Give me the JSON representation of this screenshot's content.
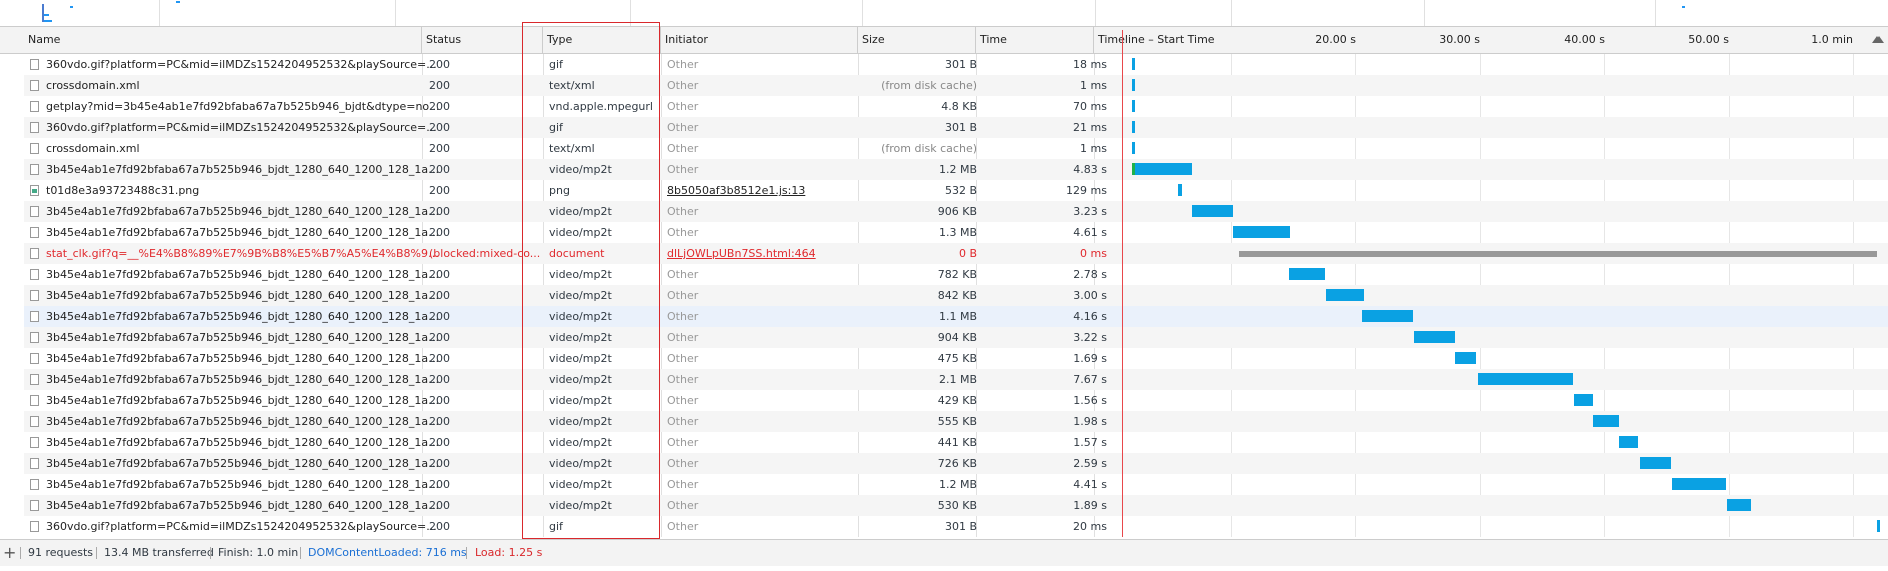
{
  "columns": {
    "name": "Name",
    "status": "Status",
    "type": "Type",
    "initiator": "Initiator",
    "size": "Size",
    "time": "Time",
    "timeline": "Timeline – Start Time"
  },
  "timeline_ticks": [
    "20.00 s",
    "30.00 s",
    "40.00 s",
    "50.00 s",
    "1.0 min"
  ],
  "rows": [
    {
      "name": "360vdo.gif?platform=PC&mid=ilMDZs1524204952532&playSource=...",
      "status": "200",
      "type": "gif",
      "initiator": "Other",
      "size": "301 B",
      "time": "18 ms",
      "icon": "file-icon"
    },
    {
      "name": "crossdomain.xml",
      "status": "200",
      "type": "text/xml",
      "initiator": "Other",
      "size": "(from disk cache)",
      "time": "1 ms",
      "icon": "file-icon"
    },
    {
      "name": "getplay?mid=3b45e4ab1e7fd92bfaba67a7b525b946_bjdt&dtype=no...",
      "status": "200",
      "type": "vnd.apple.mpegurl",
      "initiator": "Other",
      "size": "4.8 KB",
      "time": "70 ms",
      "icon": "file-icon"
    },
    {
      "name": "360vdo.gif?platform=PC&mid=ilMDZs1524204952532&playSource=...",
      "status": "200",
      "type": "gif",
      "initiator": "Other",
      "size": "301 B",
      "time": "21 ms",
      "icon": "file-icon"
    },
    {
      "name": "crossdomain.xml",
      "status": "200",
      "type": "text/xml",
      "initiator": "Other",
      "size": "(from disk cache)",
      "time": "1 ms",
      "icon": "file-icon"
    },
    {
      "name": "3b45e4ab1e7fd92bfaba67a7b525b946_bjdt_1280_640_1200_128_1abb...",
      "status": "200",
      "type": "video/mp2t",
      "initiator": "Other",
      "size": "1.2 MB",
      "time": "4.83 s",
      "icon": "file-icon"
    },
    {
      "name": "t01d8e3a93723488c31.png",
      "status": "200",
      "type": "png",
      "initiator": "8b5050af3b8512e1.js:13",
      "size": "532 B",
      "time": "129 ms",
      "icon": "image-icon"
    },
    {
      "name": "3b45e4ab1e7fd92bfaba67a7b525b946_bjdt_1280_640_1200_128_1abb...",
      "status": "200",
      "type": "video/mp2t",
      "initiator": "Other",
      "size": "906 KB",
      "time": "3.23 s",
      "icon": "file-icon"
    },
    {
      "name": "3b45e4ab1e7fd92bfaba67a7b525b946_bjdt_1280_640_1200_128_1abb...",
      "status": "200",
      "type": "video/mp2t",
      "initiator": "Other",
      "size": "1.3 MB",
      "time": "4.61 s",
      "icon": "file-icon"
    },
    {
      "name": "stat_clk.gif?q=__%E4%B8%89%E7%9B%B8%E5%B7%A5%E4%B8%9A...",
      "status": "(blocked:mixed-co...",
      "type": "document",
      "initiator": "dlLjOWLpUBn7SS.html:464",
      "size": "0 B",
      "time": "0 ms",
      "icon": "file-icon",
      "error": true
    },
    {
      "name": "3b45e4ab1e7fd92bfaba67a7b525b946_bjdt_1280_640_1200_128_1abb...",
      "status": "200",
      "type": "video/mp2t",
      "initiator": "Other",
      "size": "782 KB",
      "time": "2.78 s",
      "icon": "file-icon"
    },
    {
      "name": "3b45e4ab1e7fd92bfaba67a7b525b946_bjdt_1280_640_1200_128_1abb...",
      "status": "200",
      "type": "video/mp2t",
      "initiator": "Other",
      "size": "842 KB",
      "time": "3.00 s",
      "icon": "file-icon"
    },
    {
      "name": "3b45e4ab1e7fd92bfaba67a7b525b946_bjdt_1280_640_1200_128_1abb...",
      "status": "200",
      "type": "video/mp2t",
      "initiator": "Other",
      "size": "1.1 MB",
      "time": "4.16 s",
      "icon": "file-icon",
      "selected": true
    },
    {
      "name": "3b45e4ab1e7fd92bfaba67a7b525b946_bjdt_1280_640_1200_128_1abb...",
      "status": "200",
      "type": "video/mp2t",
      "initiator": "Other",
      "size": "904 KB",
      "time": "3.22 s",
      "icon": "file-icon"
    },
    {
      "name": "3b45e4ab1e7fd92bfaba67a7b525b946_bjdt_1280_640_1200_128_1abb...",
      "status": "200",
      "type": "video/mp2t",
      "initiator": "Other",
      "size": "475 KB",
      "time": "1.69 s",
      "icon": "file-icon"
    },
    {
      "name": "3b45e4ab1e7fd92bfaba67a7b525b946_bjdt_1280_640_1200_128_1abb...",
      "status": "200",
      "type": "video/mp2t",
      "initiator": "Other",
      "size": "2.1 MB",
      "time": "7.67 s",
      "icon": "file-icon"
    },
    {
      "name": "3b45e4ab1e7fd92bfaba67a7b525b946_bjdt_1280_640_1200_128_1abb...",
      "status": "200",
      "type": "video/mp2t",
      "initiator": "Other",
      "size": "429 KB",
      "time": "1.56 s",
      "icon": "file-icon"
    },
    {
      "name": "3b45e4ab1e7fd92bfaba67a7b525b946_bjdt_1280_640_1200_128_1abb...",
      "status": "200",
      "type": "video/mp2t",
      "initiator": "Other",
      "size": "555 KB",
      "time": "1.98 s",
      "icon": "file-icon"
    },
    {
      "name": "3b45e4ab1e7fd92bfaba67a7b525b946_bjdt_1280_640_1200_128_1abb...",
      "status": "200",
      "type": "video/mp2t",
      "initiator": "Other",
      "size": "441 KB",
      "time": "1.57 s",
      "icon": "file-icon"
    },
    {
      "name": "3b45e4ab1e7fd92bfaba67a7b525b946_bjdt_1280_640_1200_128_1abb...",
      "status": "200",
      "type": "video/mp2t",
      "initiator": "Other",
      "size": "726 KB",
      "time": "2.59 s",
      "icon": "file-icon"
    },
    {
      "name": "3b45e4ab1e7fd92bfaba67a7b525b946_bjdt_1280_640_1200_128_1abb...",
      "status": "200",
      "type": "video/mp2t",
      "initiator": "Other",
      "size": "1.2 MB",
      "time": "4.41 s",
      "icon": "file-icon"
    },
    {
      "name": "3b45e4ab1e7fd92bfaba67a7b525b946_bjdt_1280_640_1200_128_1abb...",
      "status": "200",
      "type": "video/mp2t",
      "initiator": "Other",
      "size": "530 KB",
      "time": "1.89 s",
      "icon": "file-icon"
    },
    {
      "name": "360vdo.gif?platform=PC&mid=ilMDZs1524204952532&playSource=...",
      "status": "200",
      "type": "gif",
      "initiator": "Other",
      "size": "301 B",
      "time": "20 ms",
      "icon": "file-icon"
    }
  ],
  "footer": {
    "requests": "91 requests",
    "transferred": "13.4 MB transferred",
    "finish": "Finish: 1.0 min",
    "dcl": "DOMContentLoaded: 716 ms",
    "load": "Load: 1.25 s"
  },
  "colors": {
    "bar": "#0aa1e3",
    "error": "#e0292d",
    "dcl": "#1a6fd4",
    "load": "#d9282c"
  }
}
